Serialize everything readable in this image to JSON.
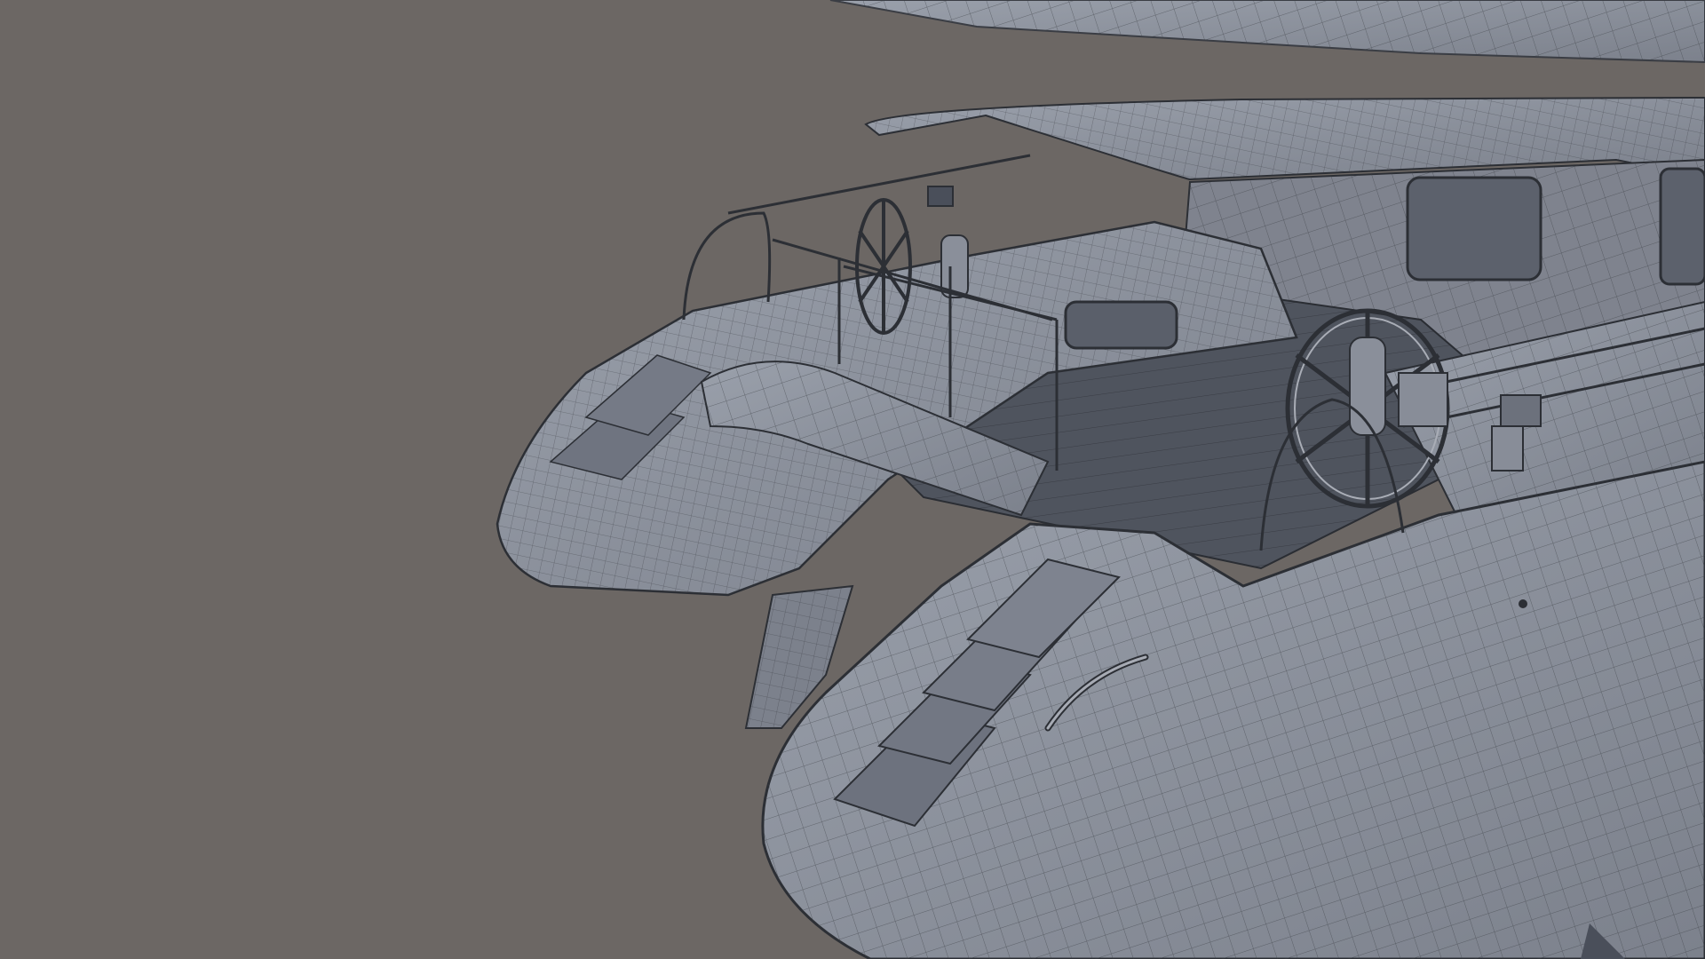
{
  "scene": {
    "background_color": "#6c6764",
    "hull_color": "#8a8e99",
    "wire_color": "#3a3d44",
    "highlight_color": "#b7bbc4"
  }
}
